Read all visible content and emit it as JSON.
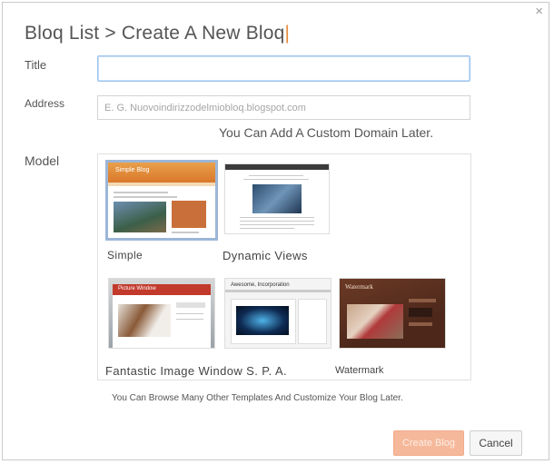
{
  "dialog": {
    "title": "Bloq List > Create A New Bloq",
    "close_glyph": "×"
  },
  "form": {
    "title_label": "Title",
    "title_value": "",
    "address_label": "Address",
    "address_placeholder": "E. G. Nuovoindirizzodelmiobloq.blogspot.com",
    "address_hint": "You Can Add A Custom Domain Later.",
    "model_label": "Model"
  },
  "templates": [
    {
      "label": "Simple",
      "selected": true,
      "thumb_title": "Simple Blog"
    },
    {
      "label": "Dynamic Views",
      "selected": false,
      "thumb_title": ""
    },
    {
      "label": "Fantastic Image Window S. P. A.",
      "selected": false,
      "thumb_title": "Picture Window"
    },
    {
      "label": "",
      "selected": false,
      "thumb_title": "Awesome, Incorporation"
    },
    {
      "label": "Watermark",
      "selected": false,
      "thumb_title": "Watermark"
    }
  ],
  "footer": {
    "hint": "You Can Browse Many Other Templates And Customize Your Blog Later.",
    "create_label": "Create Blog",
    "cancel_label": "Cancel"
  },
  "colors": {
    "accent_orange": "#e98a3c",
    "create_button": "#f6b89a",
    "focus_blue": "#9cc4ee",
    "watermark_brown": "#5a2f22"
  }
}
